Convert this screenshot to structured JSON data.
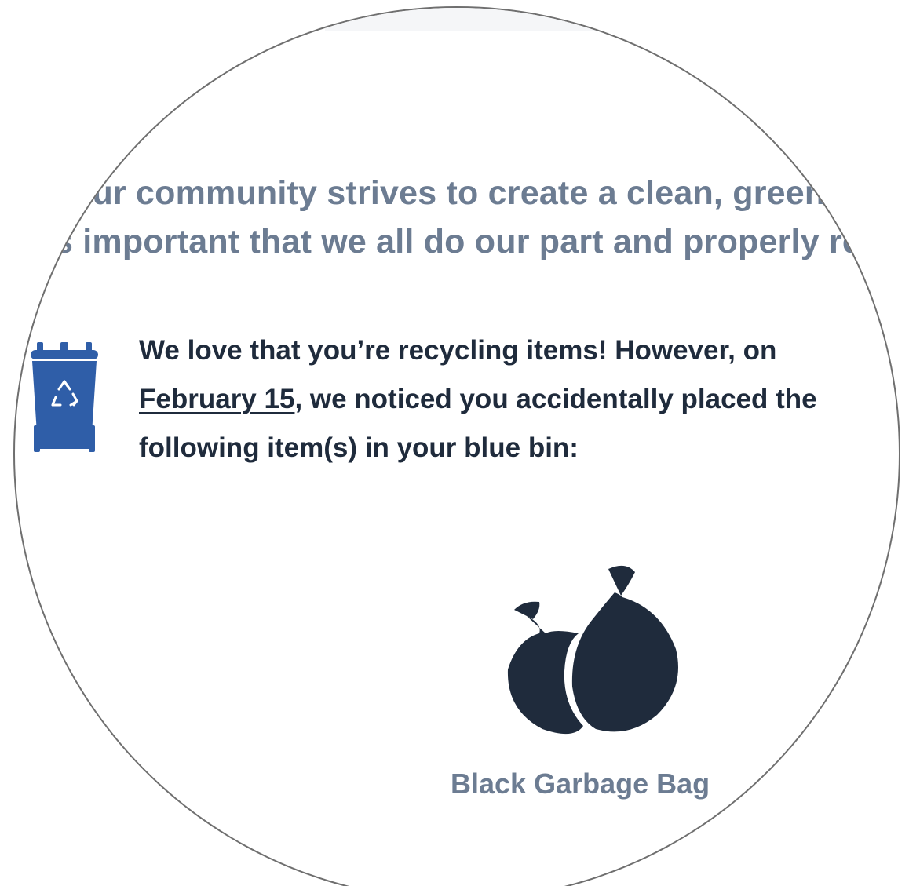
{
  "intro": {
    "line1": "our community strives to create a clean, greener",
    "line2": "s important that we all do our part and properly re"
  },
  "notice": {
    "line1": "We love that you’re recycling items! However, on",
    "date": "February 15",
    "line2_rest": ", we noticed you accidentally placed the",
    "line3": "following item(s) in your blue bin:"
  },
  "items": [
    {
      "label": "Black Garbage Bag",
      "icon": "garbage-bags-icon"
    }
  ],
  "icons": {
    "bin": "recycling-bin-icon"
  },
  "colors": {
    "bin_blue": "#2f5ea8",
    "heading_text": "#1f2b3c",
    "muted_text": "#6c7c92",
    "bag": "#1f2b3c"
  }
}
